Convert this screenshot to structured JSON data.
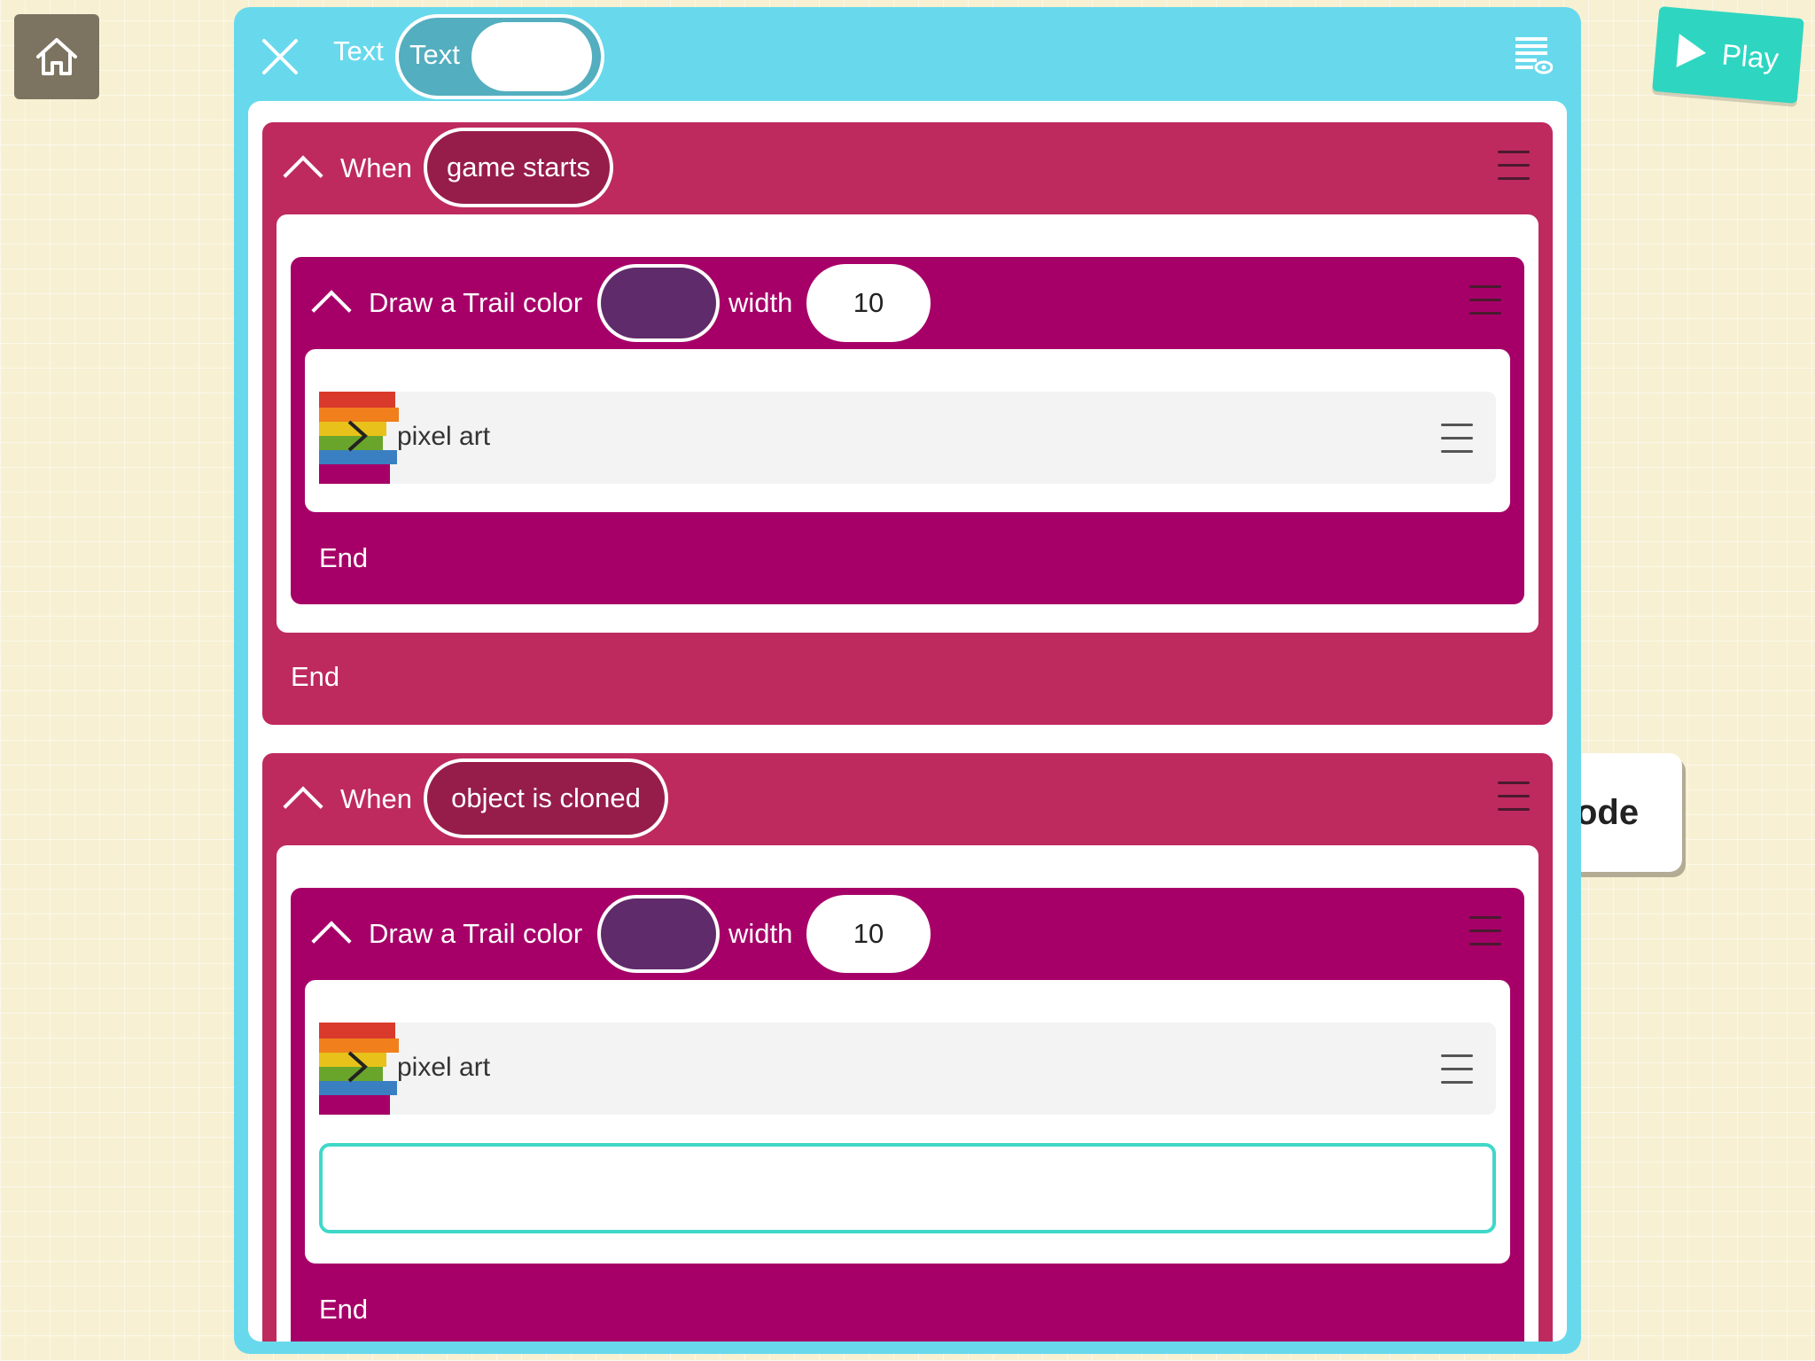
{
  "toolbar": {
    "home_icon": "home-icon",
    "play_label": "Play",
    "play_icon": "play-triangle-icon"
  },
  "side_card": {
    "label": "ode"
  },
  "editor": {
    "title": "Text",
    "toggle_label": "Text",
    "close_icon": "close-icon",
    "view_icon": "code-view-icon"
  },
  "rules": [
    {
      "when_label": "When",
      "event": "game starts",
      "block": {
        "label": "Draw a Trail color",
        "color": "#5f2b6a",
        "width_label": "width",
        "width_value": "10",
        "calls": [
          {
            "label": "pixel art",
            "icon": "rainbow-function-icon"
          }
        ],
        "end_label": "End"
      },
      "end_label": "End"
    },
    {
      "when_label": "When",
      "event": "object is cloned",
      "block": {
        "label": "Draw a Trail color",
        "color": "#5f2b6a",
        "width_label": "width",
        "width_value": "10",
        "calls": [
          {
            "label": "pixel art",
            "icon": "rainbow-function-icon"
          }
        ],
        "end_label": "End"
      }
    }
  ],
  "colors": {
    "editor_bg": "#68d9ec",
    "when_block": "#be2a5e",
    "trail_block": "#a60068",
    "event_pill": "#961d4a",
    "play_button": "#2ed6c1",
    "drop_slot_outline": "#3fd8c8"
  }
}
